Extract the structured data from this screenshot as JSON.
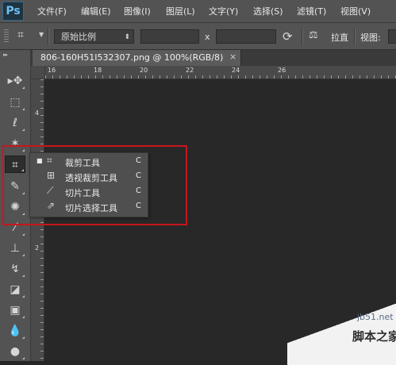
{
  "app": {
    "logo": "Ps"
  },
  "menubar": {
    "items": [
      {
        "label": "文件(F)"
      },
      {
        "label": "编辑(E)"
      },
      {
        "label": "图像(I)"
      },
      {
        "label": "图层(L)"
      },
      {
        "label": "文字(Y)"
      },
      {
        "label": "选择(S)"
      },
      {
        "label": "滤镜(T)"
      },
      {
        "label": "视图(V)"
      }
    ]
  },
  "options": {
    "ratio_value": "原始比例",
    "width_value": "",
    "height_value": "",
    "x_label": "x",
    "straighten_label": "拉直",
    "view_label": "视图:"
  },
  "document": {
    "tab_title": "806-160H51I532307.png @ 100%(RGB/8)",
    "tab_close": "×"
  },
  "rulers": {
    "horizontal": [
      "16",
      "18",
      "20",
      "22",
      "24",
      "26"
    ],
    "vertical": [
      "4",
      "2"
    ]
  },
  "flyout": {
    "items": [
      {
        "label": "裁剪工具",
        "key": "C",
        "selected": true,
        "icon": "crop-icon"
      },
      {
        "label": "透视裁剪工具",
        "key": "C",
        "selected": false,
        "icon": "perspective-crop-icon"
      },
      {
        "label": "切片工具",
        "key": "C",
        "selected": false,
        "icon": "slice-icon"
      },
      {
        "label": "切片选择工具",
        "key": "C",
        "selected": false,
        "icon": "slice-select-icon"
      }
    ]
  },
  "watermark": {
    "url": "jb51.net",
    "name": "脚本之家"
  },
  "colors": {
    "highlight": "#c8161d",
    "panel": "#535353",
    "canvas": "#282828"
  }
}
